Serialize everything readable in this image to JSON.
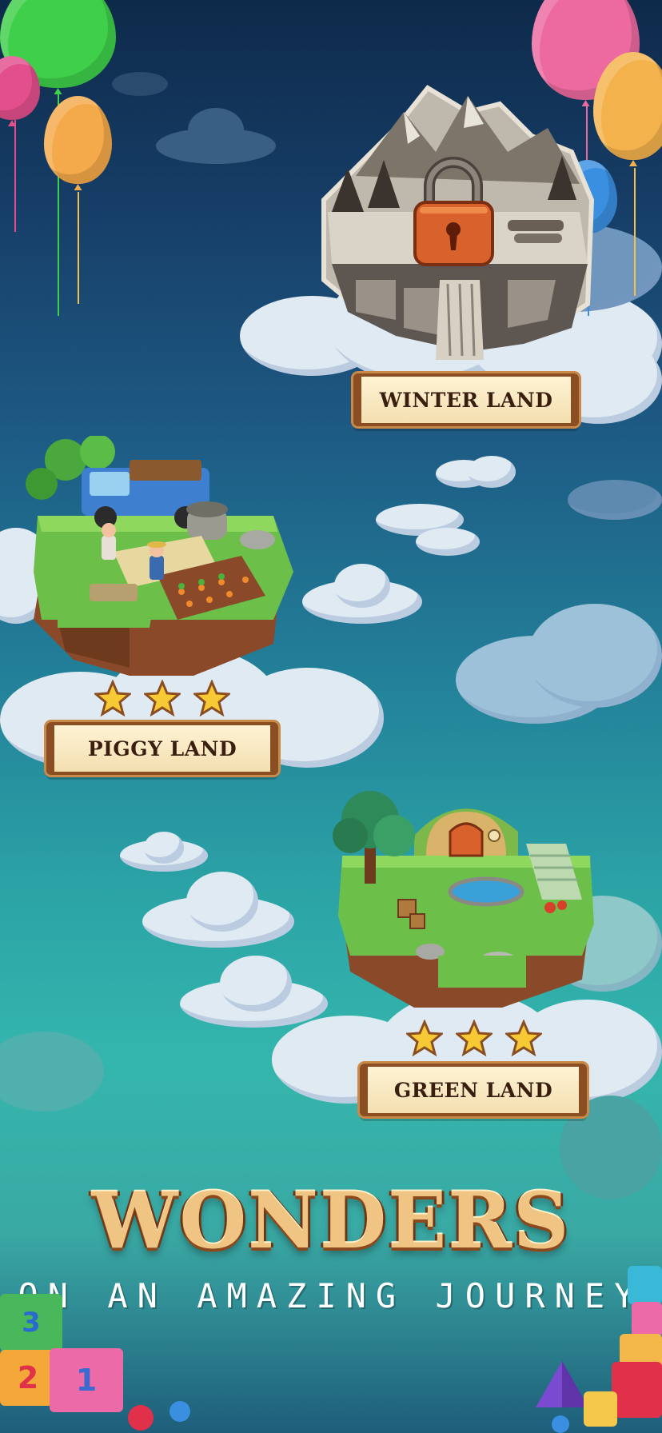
{
  "lands": [
    {
      "name": "WINTER LAND",
      "locked": true,
      "stars": 0
    },
    {
      "name": "PIGGY LAND",
      "locked": false,
      "stars": 3
    },
    {
      "name": "GREEN LAND",
      "locked": false,
      "stars": 3
    }
  ],
  "headline": "WONDERS",
  "tagline": "ON AN AMAZING JOURNEY",
  "colors": {
    "star": "#f6c935",
    "lock": "#d9622c",
    "label_border": "#8a4e22",
    "label_fill": "#f3dfb0"
  },
  "toy_blocks": [
    "3",
    "2",
    "1"
  ]
}
